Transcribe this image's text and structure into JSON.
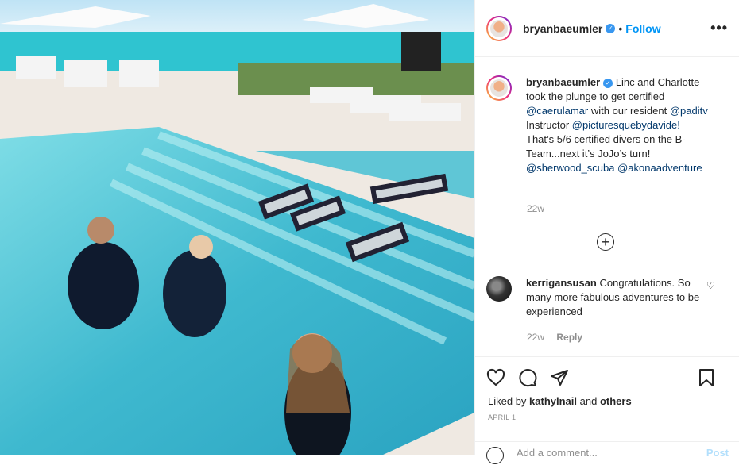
{
  "post": {
    "username": "bryanbaeumler",
    "follow_label": "Follow",
    "more_label": "•••",
    "caption": {
      "username": "bryanbaeumler",
      "line1": " Linc and Charlotte took the plunge to get certified ",
      "mention1": "@caerulamar",
      "line2": " with our resident ",
      "mention2": "@paditv",
      "line3": " Instructor ",
      "mention3": "@picturesquebydavide!",
      "line4": "That’s 5/6 certified divers on the B-Team...next it’s JoJo’s turn!",
      "mention4": "@sherwood_scuba",
      "mention5": "@akonaadventure"
    },
    "caption_time": "22w",
    "comment": {
      "username": "kerrigansusan",
      "text": " Congratulations. So many more fabulous adventures to be experienced",
      "time": "22w",
      "reply_label": "Reply"
    },
    "likes": {
      "prefix": "Liked by ",
      "user": "kathylnail",
      "and": " and ",
      "others": "others"
    },
    "date": "APRIL 1",
    "add_comment_placeholder": "Add a comment...",
    "post_button": "Post"
  },
  "icons": {
    "verified": "verified-badge-icon",
    "more": "more-options-icon",
    "plus": "load-more-comments-icon",
    "heart": "heart-icon",
    "comment": "comment-icon",
    "share": "share-icon",
    "bookmark": "bookmark-icon",
    "emoji": "emoji-icon"
  },
  "colors": {
    "follow": "#0095f6",
    "link": "#00376b",
    "muted": "#8e8e8e",
    "verified": "#3897f0"
  }
}
